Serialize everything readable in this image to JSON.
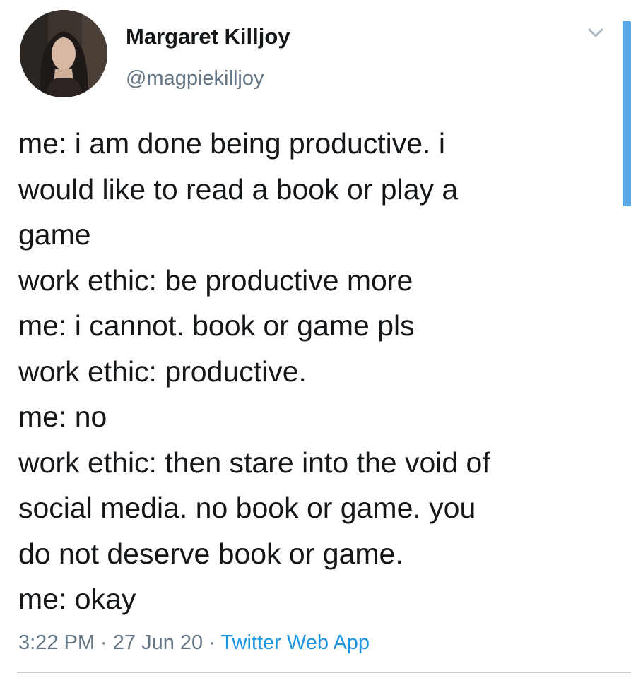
{
  "author": {
    "display_name": "Margaret Killjoy",
    "handle": "@magpiekilljoy",
    "avatar_icon": "user-avatar"
  },
  "tweet": {
    "lines": [
      "me: i am done being productive. i",
      "would like to read a book or play a",
      "game",
      "work ethic: be productive more",
      "me: i cannot. book or game pls",
      "work ethic: productive.",
      "me: no",
      "work ethic: then stare into the void of",
      "social media. no book or game. you",
      "do not deserve book or game.",
      "me: okay"
    ]
  },
  "meta": {
    "time": "3:22 PM",
    "date": "27 Jun 20",
    "source": "Twitter Web App",
    "separator": " · "
  },
  "colors": {
    "text": "#14171a",
    "secondary": "#657786",
    "link": "#1b95e0"
  },
  "icons": {
    "menu": "chevron-down-icon"
  }
}
